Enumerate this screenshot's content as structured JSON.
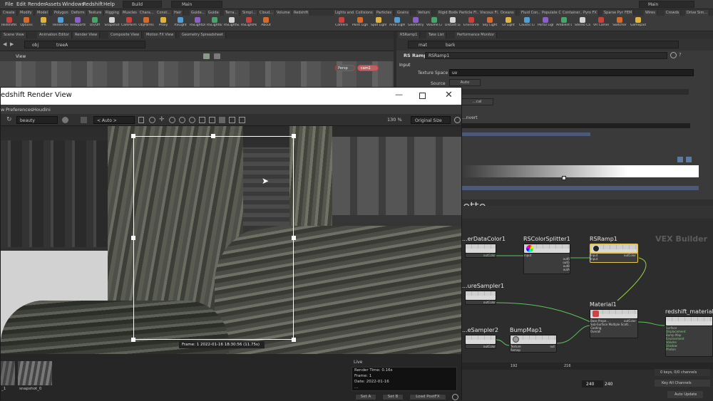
{
  "menubar": {
    "items": [
      "File",
      "Edit",
      "Render",
      "Assets",
      "Windows",
      "Redshift",
      "Help"
    ],
    "build_desktop": "Build",
    "main_desktop": "Main",
    "right_main": "Main"
  },
  "shelf_tabs_left": [
    "Create",
    "Modify",
    "Model",
    "Polygon",
    "Deform",
    "Texture",
    "Rigging",
    "Muscles",
    "Chara...",
    "Const...",
    "Hair",
    "Guide...",
    "Guide",
    "Terra...",
    "Simpl...",
    "Cloud...",
    "Volume",
    "Redshift"
  ],
  "shelf_tabs_right": [
    "Lights and...",
    "Collisions",
    "Particles",
    "Grains",
    "Vellum",
    "Rigid Bodies",
    "Particle Fl...",
    "Viscous Fl...",
    "Oceans",
    "Fluid Con...",
    "Populate C...",
    "Container...",
    "Pyro FX",
    "Sparse Pyr...",
    "FEM",
    "Wires",
    "Crowds",
    "Drive Sim..."
  ],
  "shelf_tools_left": [
    "RedshiftR...",
    "Options",
    "IPR",
    "RenderView",
    "ViewportIPR",
    "On/Off",
    "Snapshot",
    "CamParms",
    "ObjParms",
    "Proxy",
    "RSLight",
    "RSLightDome",
    "RSLightIES",
    "RSLightSun",
    "RSLightPortal",
    "About"
  ],
  "shelf_tools_right": [
    "Camera",
    "Point Light",
    "Spot Light",
    "Area Light",
    "Geometry Light",
    "Volume Light",
    "Distant Light",
    "Environment Light",
    "Sky Light",
    "GI Light",
    "Caustic Light",
    "Portal Light",
    "Ambient Light",
    "Stereo Camera",
    "VR Camera",
    "Switcher",
    "Gamepad Camera"
  ],
  "left_pane_tabs": [
    "Scene View",
    "Animation Editor",
    "Render View",
    "Composite View",
    "Motion FX View",
    "Geometry Spreadsheet"
  ],
  "left_path": {
    "context": "obj",
    "node": "treeA"
  },
  "viewport": {
    "title": "View",
    "persp": "Persp",
    "cam": "cam1"
  },
  "right_pane_tabs": [
    "RSRamp1",
    "Take List",
    "Performance Monitor"
  ],
  "right_path": {
    "context": "mat",
    "node": "bark"
  },
  "params": {
    "node_type": "RS Ramp",
    "node_name": "RSRamp1",
    "section": "Input",
    "texture_space_label": "Texture Space",
    "texture_space_value": "uv",
    "source_label": "Source",
    "source_value": "Auto",
    "interp_value": "...cal",
    "invert_label": "...nvert"
  },
  "net_pane_tabs": [
    "Material Palette",
    "Asset Browser"
  ],
  "net_menu": [
    "...ls",
    "Layout",
    "Labs",
    "Help"
  ],
  "net_watermark": "VEX Builder",
  "nodes": [
    {
      "label": "...erDataColor1",
      "pins": [
        "outColor"
      ]
    },
    {
      "label": "RSColorSplitter1",
      "pins": [
        "input",
        "outR",
        "outG",
        "outB",
        "outA"
      ]
    },
    {
      "label": "RSRamp1",
      "pins": [
        "Input",
        "Input",
        "outColor"
      ]
    },
    {
      "label": "...ureSampler1",
      "pins": [
        "outColor"
      ]
    },
    {
      "label": "Material1",
      "pins": [
        "Base Prope...",
        "Sub-Surface Multiple Scatt...",
        "Coating",
        "Overall",
        "outColor"
      ]
    },
    {
      "label": "redshift_material",
      "pins": [
        "Surface",
        "Displacement",
        "Bump Map",
        "Environment",
        "Volume",
        "Shadow",
        "Photon"
      ]
    },
    {
      "label": "...eSampler2",
      "pins": [
        "outColor"
      ]
    },
    {
      "label": "BumpMap1",
      "pins": [
        "Texture",
        "Remap",
        "out"
      ]
    }
  ],
  "timeline": {
    "frame_a": "240",
    "frame_b": "240",
    "keys": "0 keys, 0/0 channels",
    "key_all": "Key All Channels",
    "auto_update": "Auto Update",
    "ticks": [
      "192",
      "216"
    ]
  },
  "render_view": {
    "title": "edshift Render View",
    "menu": [
      "w",
      "Preferences",
      "Houdini"
    ],
    "aov": "beauty",
    "camera": "< Auto >",
    "zoom": "130 %",
    "size": "Original Size",
    "frame_info": "Frame: 1  2022-01-16 18:30:56  (11.75s)",
    "snapshots": [
      "_1",
      "snapshot_0"
    ],
    "live_label": "Live",
    "info_lines": [
      "Render Time: 0.16s",
      "Frame: 1",
      "Date: 2022-01-16",
      "..."
    ],
    "buttons": [
      "Set A",
      "Set B",
      "Load PostFX"
    ]
  }
}
